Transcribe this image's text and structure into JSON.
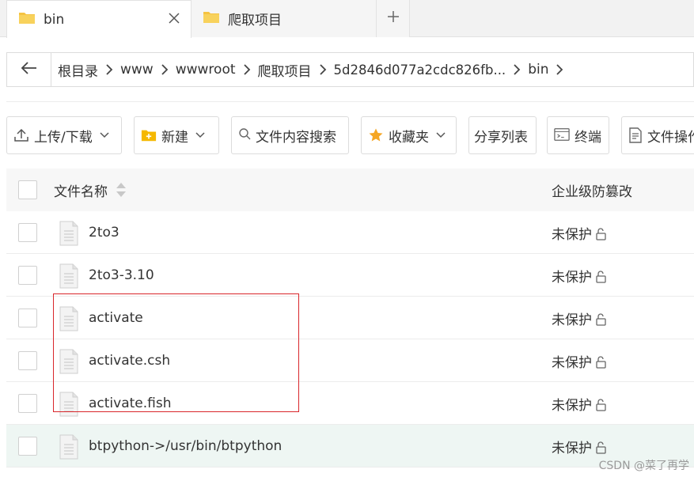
{
  "tabs": [
    {
      "label": "bin",
      "active": true,
      "icon": "folder-icon"
    },
    {
      "label": "爬取项目",
      "active": false,
      "icon": "folder-icon"
    }
  ],
  "new_tab_symbol": "+",
  "breadcrumb": [
    "根目录",
    "www",
    "wwwroot",
    "爬取项目",
    "5d2846d077a2cdc826fb...",
    "bin"
  ],
  "toolbar": {
    "upload_download": "上传/下载",
    "new": "新建",
    "content_search": "文件内容搜索",
    "favorites": "收藏夹",
    "share_list": "分享列表",
    "terminal": "终端",
    "file_ops": "文件操作"
  },
  "table": {
    "col_name": "文件名称",
    "col_protection": "企业级防篡改",
    "rows": [
      {
        "name": "2to3",
        "status": "未保护"
      },
      {
        "name": "2to3-3.10",
        "status": "未保护"
      },
      {
        "name": "activate",
        "status": "未保护"
      },
      {
        "name": "activate.csh",
        "status": "未保护"
      },
      {
        "name": "activate.fish",
        "status": "未保护"
      },
      {
        "name": "btpython->/usr/bin/btpython",
        "status": "未保护"
      }
    ]
  },
  "colors": {
    "folder": "#f5c342",
    "highlight_row": "#eef6f3",
    "annotation_box": "#d9262b",
    "favorite_star": "#f5a623"
  },
  "watermark": "CSDN @菜了再学"
}
